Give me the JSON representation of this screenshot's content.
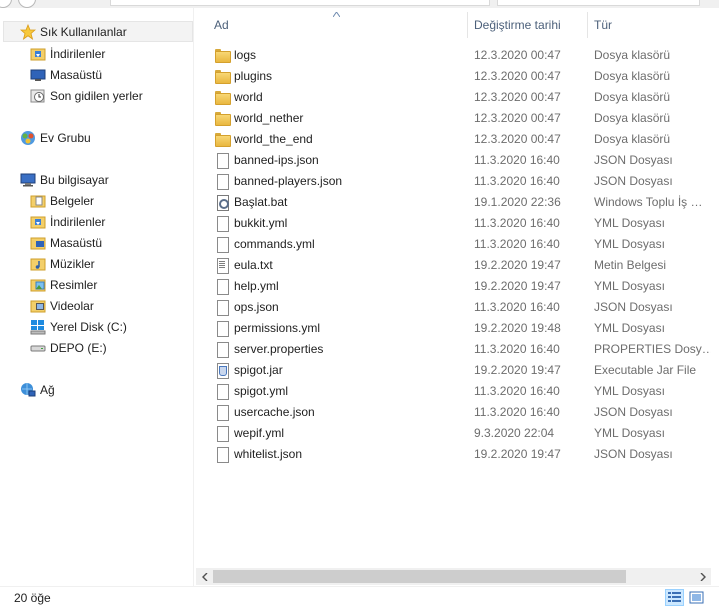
{
  "nav": {
    "favorites": {
      "label": "Sık Kullanılanlar",
      "icon": "star-icon"
    },
    "favorites_items": [
      {
        "label": "İndirilenler",
        "icon": "downloads-folder-icon"
      },
      {
        "label": "Masaüstü",
        "icon": "desktop-icon"
      },
      {
        "label": "Son gidilen yerler",
        "icon": "recent-places-icon"
      }
    ],
    "homegroup": {
      "label": "Ev Grubu",
      "icon": "homegroup-icon"
    },
    "computer": {
      "label": "Bu bilgisayar",
      "icon": "computer-icon"
    },
    "computer_items": [
      {
        "label": "Belgeler",
        "icon": "documents-icon"
      },
      {
        "label": "İndirilenler",
        "icon": "downloads-folder-icon"
      },
      {
        "label": "Masaüstü",
        "icon": "desktop-folder-icon"
      },
      {
        "label": "Müzikler",
        "icon": "music-icon"
      },
      {
        "label": "Resimler",
        "icon": "pictures-icon"
      },
      {
        "label": "Videolar",
        "icon": "videos-icon"
      },
      {
        "label": "Yerel Disk (C:)",
        "icon": "windows-drive-icon"
      },
      {
        "label": "DEPO (E:)",
        "icon": "drive-icon"
      }
    ],
    "network": {
      "label": "Ağ",
      "icon": "network-icon"
    }
  },
  "columns": {
    "name": "Ad",
    "date": "Değiştirme tarihi",
    "type": "Tür"
  },
  "files": [
    {
      "name": "logs",
      "date": "12.3.2020 00:47",
      "type": "Dosya klasörü",
      "kind": "folder"
    },
    {
      "name": "plugins",
      "date": "12.3.2020 00:47",
      "type": "Dosya klasörü",
      "kind": "folder"
    },
    {
      "name": "world",
      "date": "12.3.2020 00:47",
      "type": "Dosya klasörü",
      "kind": "folder"
    },
    {
      "name": "world_nether",
      "date": "12.3.2020 00:47",
      "type": "Dosya klasörü",
      "kind": "folder"
    },
    {
      "name": "world_the_end",
      "date": "12.3.2020 00:47",
      "type": "Dosya klasörü",
      "kind": "folder"
    },
    {
      "name": "banned-ips.json",
      "date": "11.3.2020 16:40",
      "type": "JSON Dosyası",
      "kind": "file"
    },
    {
      "name": "banned-players.json",
      "date": "11.3.2020 16:40",
      "type": "JSON Dosyası",
      "kind": "file"
    },
    {
      "name": "Başlat.bat",
      "date": "19.1.2020 22:36",
      "type": "Windows Toplu İş …",
      "kind": "bat"
    },
    {
      "name": "bukkit.yml",
      "date": "11.3.2020 16:40",
      "type": "YML Dosyası",
      "kind": "file"
    },
    {
      "name": "commands.yml",
      "date": "11.3.2020 16:40",
      "type": "YML Dosyası",
      "kind": "file"
    },
    {
      "name": "eula.txt",
      "date": "19.2.2020 19:47",
      "type": "Metin Belgesi",
      "kind": "txt"
    },
    {
      "name": "help.yml",
      "date": "19.2.2020 19:47",
      "type": "YML Dosyası",
      "kind": "file"
    },
    {
      "name": "ops.json",
      "date": "11.3.2020 16:40",
      "type": "JSON Dosyası",
      "kind": "file"
    },
    {
      "name": "permissions.yml",
      "date": "19.2.2020 19:48",
      "type": "YML Dosyası",
      "kind": "file"
    },
    {
      "name": "server.properties",
      "date": "11.3.2020 16:40",
      "type": "PROPERTIES Dosy…",
      "kind": "file"
    },
    {
      "name": "spigot.jar",
      "date": "19.2.2020 19:47",
      "type": "Executable Jar File",
      "kind": "jar"
    },
    {
      "name": "spigot.yml",
      "date": "11.3.2020 16:40",
      "type": "YML Dosyası",
      "kind": "file"
    },
    {
      "name": "usercache.json",
      "date": "11.3.2020 16:40",
      "type": "JSON Dosyası",
      "kind": "file"
    },
    {
      "name": "wepif.yml",
      "date": "9.3.2020 22:04",
      "type": "YML Dosyası",
      "kind": "file"
    },
    {
      "name": "whitelist.json",
      "date": "19.2.2020 19:47",
      "type": "JSON Dosyası",
      "kind": "file"
    }
  ],
  "status": {
    "count": "20 öğe"
  }
}
